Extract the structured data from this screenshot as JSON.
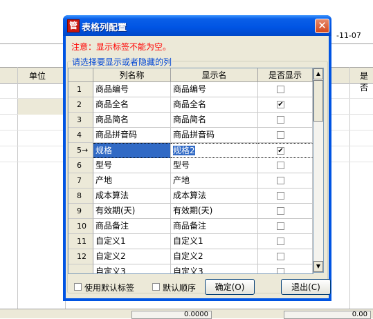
{
  "background": {
    "date_fragment": "-11-07",
    "header_unit": "单位",
    "header_right": "是否",
    "footer_values": [
      "0.0000",
      "0.00"
    ]
  },
  "dialog": {
    "icon_glyph": "管",
    "title": "表格列配置",
    "notice": "注意：显示标签不能为空。",
    "group_label": "请选择要显示或者隐藏的列",
    "columns": [
      "列名称",
      "显示名",
      "是否显示"
    ],
    "rows": [
      {
        "idx": "1",
        "name": "商品编号",
        "display": "商品编号",
        "visible": false
      },
      {
        "idx": "2",
        "name": "商品全名",
        "display": "商品全名",
        "visible": true
      },
      {
        "idx": "3",
        "name": "商品简名",
        "display": "商品简名",
        "visible": false
      },
      {
        "idx": "4",
        "name": "商品拼音码",
        "display": "商品拼音码",
        "visible": false
      },
      {
        "idx": "5→",
        "name": "规格",
        "display": "规格2",
        "visible": true
      },
      {
        "idx": "6",
        "name": "型号",
        "display": "型号",
        "visible": false
      },
      {
        "idx": "7",
        "name": "产地",
        "display": "产地",
        "visible": false
      },
      {
        "idx": "8",
        "name": "成本算法",
        "display": "成本算法",
        "visible": false
      },
      {
        "idx": "9",
        "name": "有效期(天)",
        "display": "有效期(天)",
        "visible": false
      },
      {
        "idx": "10",
        "name": "商品备注",
        "display": "商品备注",
        "visible": false
      },
      {
        "idx": "11",
        "name": "自定义1",
        "display": "自定义1",
        "visible": false
      },
      {
        "idx": "12",
        "name": "自定义2",
        "display": "自定义2",
        "visible": false
      },
      {
        "idx": "",
        "name": "自定义3",
        "display": "自定义3",
        "visible": false
      }
    ],
    "check_mark": "✔",
    "use_default_labels": "使用默认标签",
    "default_order": "默认顺序",
    "ok_label": "确定(O)",
    "cancel_label": "退出(C)",
    "close_glyph": "✕",
    "scroll_up": "▲",
    "scroll_down": "▼"
  }
}
